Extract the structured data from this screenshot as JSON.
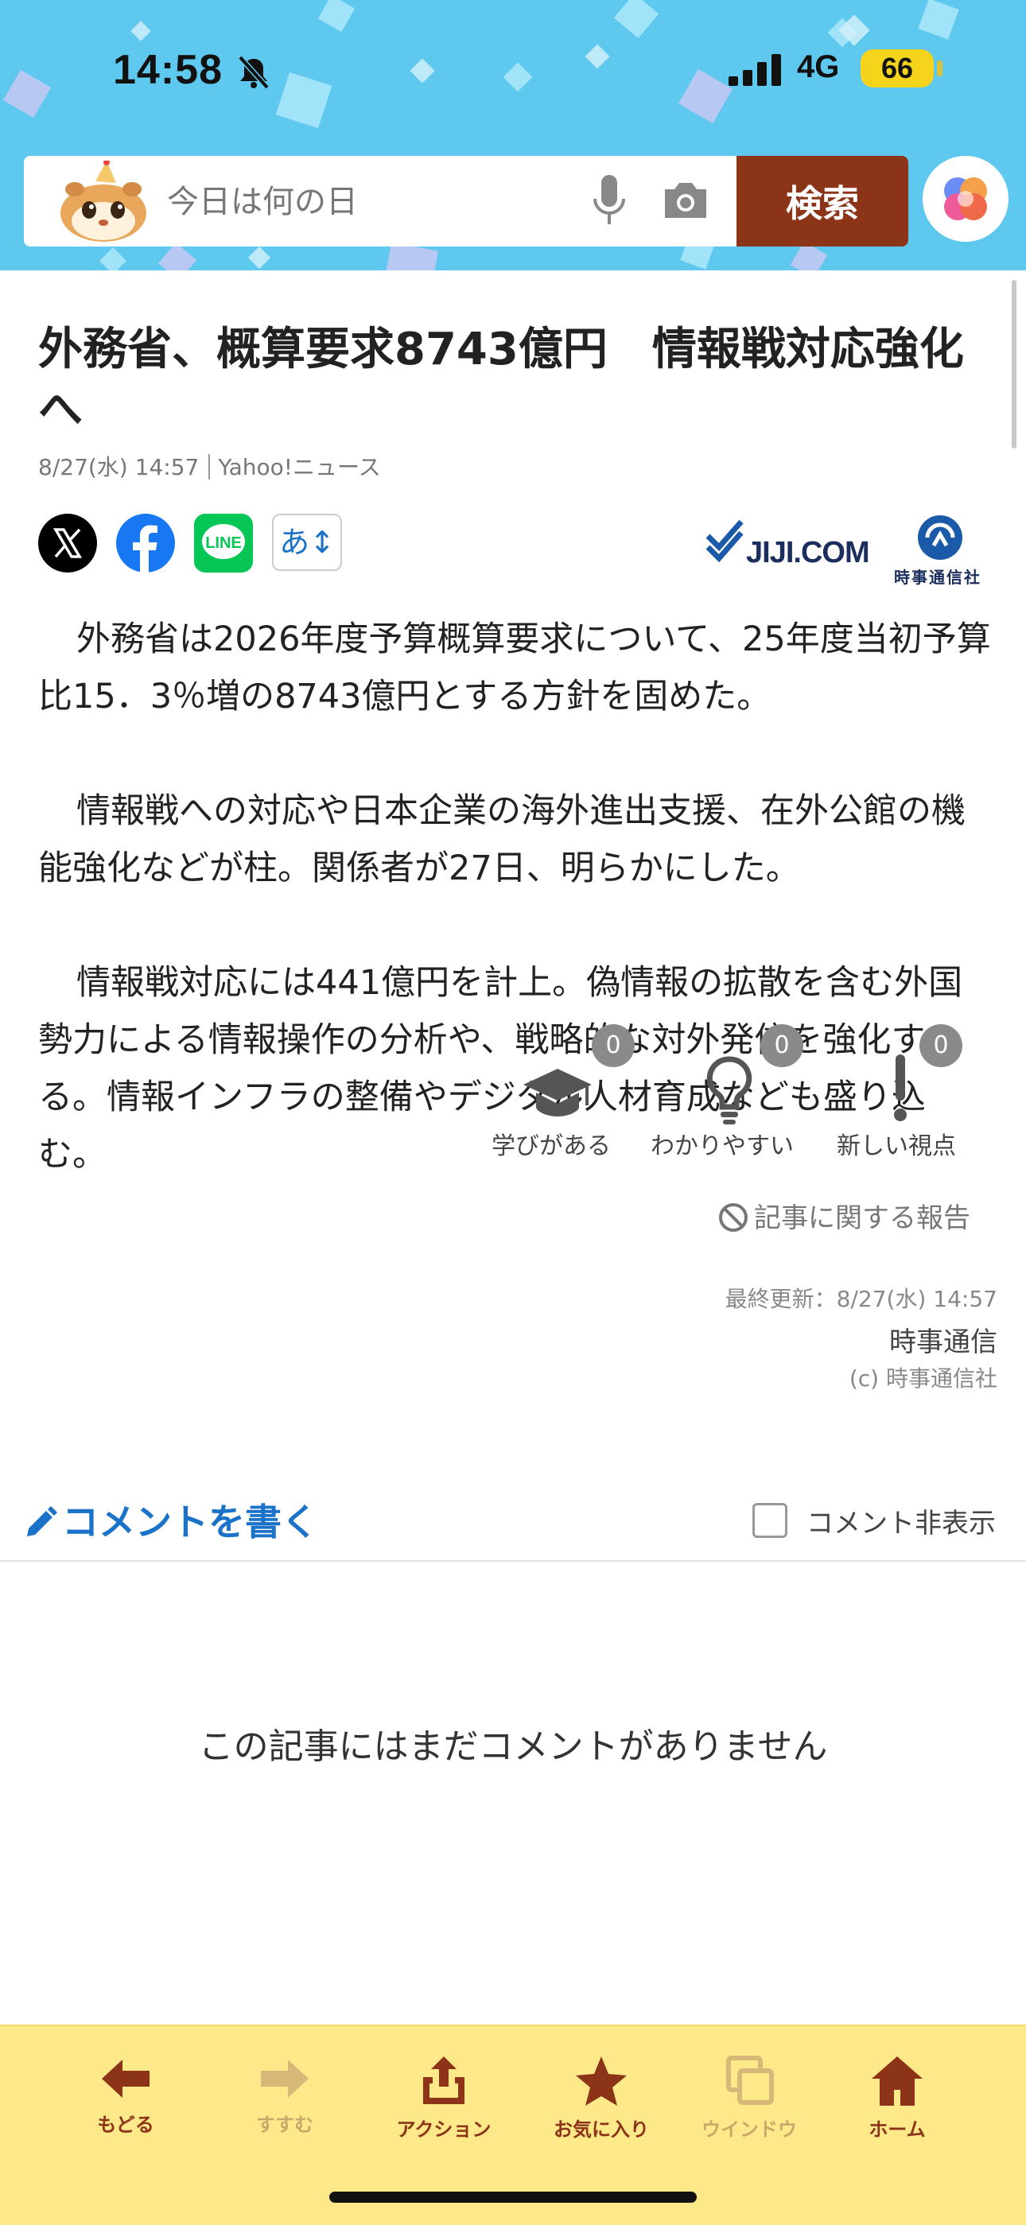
{
  "status_bar": {
    "time": "14:58",
    "network": "4G",
    "battery": "66"
  },
  "search": {
    "placeholder": "今日は何の日",
    "button_label": "検索"
  },
  "article": {
    "title": "外務省、概算要求8743億円　情報戦対応強化へ",
    "date": "8/27(水) 14:57",
    "provider": "Yahoo!ニュース",
    "font_size_button": "あ↕",
    "publisher_logo": "JIJI.COM",
    "publisher_logo_sub": "時事通信社",
    "paragraphs": [
      "外務省は2026年度予算概算要求について、25年度当初予算比15．3％増の8743億円とする方針を固めた。",
      "情報戦への対応や日本企業の海外進出支援、在外公館の機能強化などが柱。関係者が27日、明らかにした。",
      "情報戦対応には441億円を計上。偽情報の拡散を含む外国勢力による情報操作の分析や、戦略的な対外発信を強化する。情報インフラの整備やデジタル人材育成なども盛り込む。"
    ],
    "reactions": [
      {
        "label": "学びがある",
        "count": "0",
        "icon": "graduation-cap-icon"
      },
      {
        "label": "わかりやすい",
        "count": "0",
        "icon": "lightbulb-icon"
      },
      {
        "label": "新しい視点",
        "count": "0",
        "icon": "exclamation-icon"
      }
    ],
    "report_label": "記事に関する報告",
    "last_updated": "最終更新：8/27(水) 14:57",
    "source": "時事通信",
    "copyright": "(c) 時事通信社"
  },
  "comments": {
    "write_label": "コメントを書く",
    "hide_label": "コメント非表示",
    "empty_message": "この記事にはまだコメントがありません"
  },
  "toolbar": {
    "items": [
      {
        "label": "もどる",
        "icon": "back-arrow-icon",
        "color": "#8b3418"
      },
      {
        "label": "すすむ",
        "icon": "forward-arrow-icon",
        "color": "#c9a86a"
      },
      {
        "label": "アクション",
        "icon": "share-icon",
        "color": "#8b3418"
      },
      {
        "label": "お気に入り",
        "icon": "star-icon",
        "color": "#8b3418"
      },
      {
        "label": "ウインドウ",
        "icon": "window-icon",
        "color": "#c9a86a"
      },
      {
        "label": "ホーム",
        "icon": "home-icon",
        "color": "#8b3418"
      }
    ]
  },
  "colors": {
    "header_bg": "#5ec8ef",
    "search_button": "#8b3418",
    "link_blue": "#1a73c9",
    "toolbar_bg": "#fde98a"
  }
}
